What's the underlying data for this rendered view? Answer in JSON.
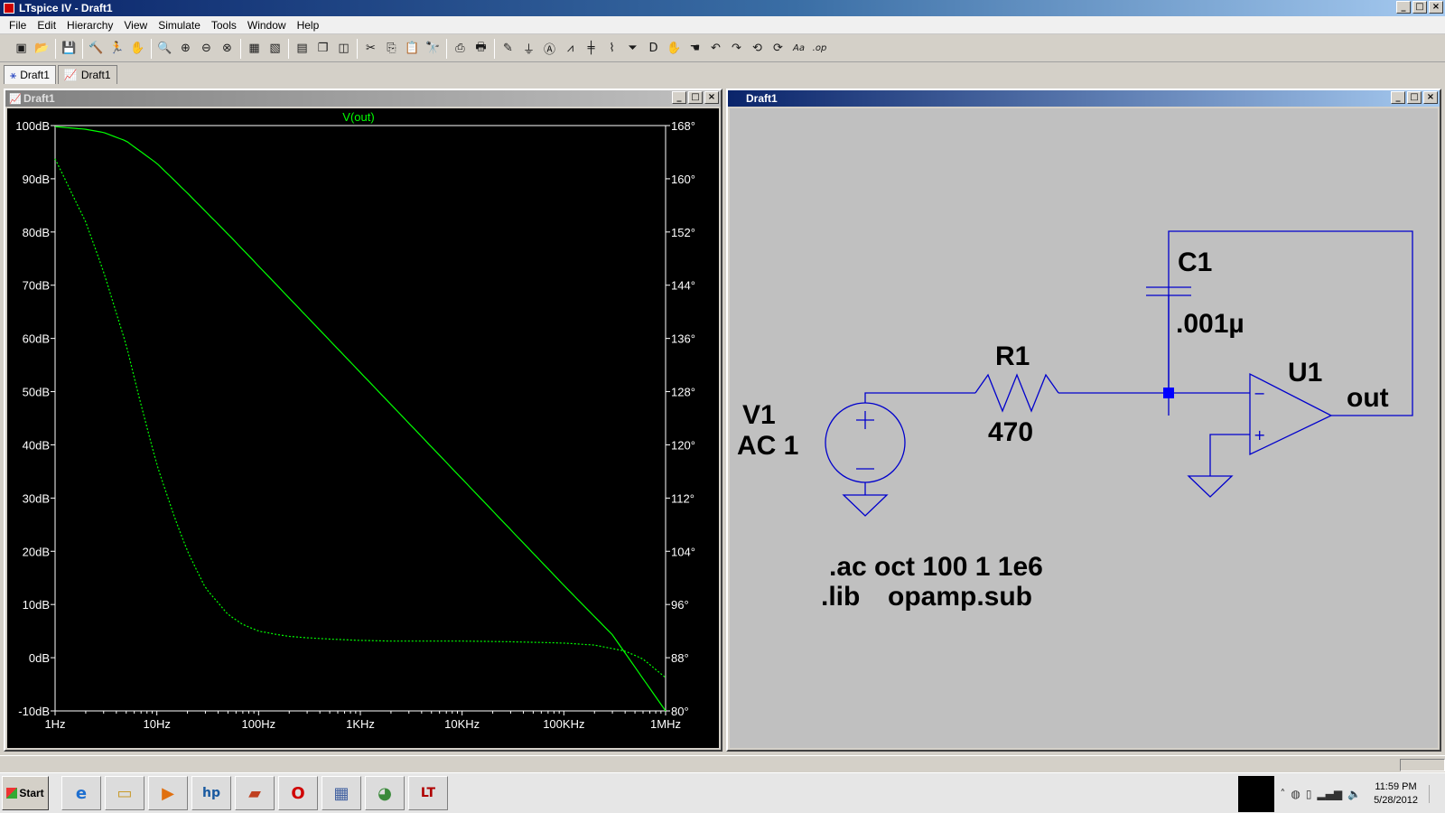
{
  "window": {
    "title": "LTspice IV - Draft1"
  },
  "window_controls": [
    "_",
    "□",
    "×"
  ],
  "menu": [
    "File",
    "Edit",
    "Hierarchy",
    "View",
    "Simulate",
    "Tools",
    "Window",
    "Help"
  ],
  "toolbar": {
    "groups": [
      [
        {
          "name": "new-schematic-icon",
          "glyph": "▣"
        },
        {
          "name": "open-icon",
          "glyph": "📂"
        }
      ],
      [
        {
          "name": "save-icon",
          "glyph": "💾"
        }
      ],
      [
        {
          "name": "control-panel-icon",
          "glyph": "🔨"
        },
        {
          "name": "run-icon",
          "glyph": "🏃"
        },
        {
          "name": "halt-icon",
          "glyph": "✋"
        }
      ],
      [
        {
          "name": "zoom-in-icon",
          "glyph": "🔍"
        },
        {
          "name": "zoom-pan-icon",
          "glyph": "⊕"
        },
        {
          "name": "zoom-out-icon",
          "glyph": "⊖"
        },
        {
          "name": "zoom-fit-icon",
          "glyph": "⊗"
        }
      ],
      [
        {
          "name": "autorange-icon",
          "glyph": "▦"
        },
        {
          "name": "delete-traces-icon",
          "glyph": "▧"
        }
      ],
      [
        {
          "name": "tile-horizontal-icon",
          "glyph": "▤"
        },
        {
          "name": "cascade-icon",
          "glyph": "❐"
        },
        {
          "name": "tile-vertical-icon",
          "glyph": "◫"
        }
      ],
      [
        {
          "name": "cut-icon",
          "glyph": "✂"
        },
        {
          "name": "copy-icon",
          "glyph": "⎘"
        },
        {
          "name": "paste-icon",
          "glyph": "📋"
        },
        {
          "name": "find-icon",
          "glyph": "🔭"
        }
      ],
      [
        {
          "name": "print-setup-icon",
          "glyph": "⎙"
        },
        {
          "name": "print-icon",
          "glyph": "🖶"
        }
      ],
      [
        {
          "name": "wire-icon",
          "glyph": "✎"
        },
        {
          "name": "ground-icon",
          "glyph": "⏚"
        },
        {
          "name": "label-net-icon",
          "glyph": "Ⓐ"
        },
        {
          "name": "resistor-icon",
          "glyph": "⩘"
        },
        {
          "name": "capacitor-icon",
          "glyph": "╪"
        },
        {
          "name": "inductor-icon",
          "glyph": "⌇"
        },
        {
          "name": "diode-icon",
          "glyph": "⏷"
        },
        {
          "name": "component-icon",
          "glyph": "D"
        },
        {
          "name": "move-icon",
          "glyph": "✋"
        },
        {
          "name": "drag-icon",
          "glyph": "☚"
        },
        {
          "name": "undo-icon",
          "glyph": "↶"
        },
        {
          "name": "redo-icon",
          "glyph": "↷"
        },
        {
          "name": "rotate-icon",
          "glyph": "⟲"
        },
        {
          "name": "mirror-icon",
          "glyph": "⟳"
        },
        {
          "name": "text-icon",
          "glyph": "Aa"
        },
        {
          "name": "spice-directive-icon",
          "glyph": ".op"
        }
      ]
    ]
  },
  "tabs": [
    {
      "label": "Draft1",
      "icon": "schematic-icon",
      "glyph": "⚹"
    },
    {
      "label": "Draft1",
      "icon": "waveform-icon",
      "glyph": "📈"
    }
  ],
  "waveform_window": {
    "title": "Draft1",
    "trace_label": "V(out)",
    "colors": {
      "background": "#000000",
      "trace": "#00ff00",
      "axis": "#ffffff",
      "label": "#00ff00"
    }
  },
  "chart_data": {
    "type": "line",
    "x_scale": "log",
    "xlim": [
      1,
      1000000
    ],
    "x_ticks": [
      {
        "v": 1,
        "label": "1Hz"
      },
      {
        "v": 10,
        "label": "10Hz"
      },
      {
        "v": 100,
        "label": "100Hz"
      },
      {
        "v": 1000,
        "label": "1KHz"
      },
      {
        "v": 10000,
        "label": "10KHz"
      },
      {
        "v": 100000,
        "label": "100KHz"
      },
      {
        "v": 1000000,
        "label": "1MHz"
      }
    ],
    "y_left": {
      "lim": [
        -10,
        100
      ],
      "ticks": [
        {
          "v": 100,
          "label": "100dB"
        },
        {
          "v": 90,
          "label": "90dB"
        },
        {
          "v": 80,
          "label": "80dB"
        },
        {
          "v": 70,
          "label": "70dB"
        },
        {
          "v": 60,
          "label": "60dB"
        },
        {
          "v": 50,
          "label": "50dB"
        },
        {
          "v": 40,
          "label": "40dB"
        },
        {
          "v": 30,
          "label": "30dB"
        },
        {
          "v": 20,
          "label": "20dB"
        },
        {
          "v": 10,
          "label": "10dB"
        },
        {
          "v": 0,
          "label": "0dB"
        },
        {
          "v": -10,
          "label": "-10dB"
        }
      ]
    },
    "y_right": {
      "lim": [
        80,
        168
      ],
      "ticks": [
        {
          "v": 168,
          "label": "168°"
        },
        {
          "v": 160,
          "label": "160°"
        },
        {
          "v": 152,
          "label": "152°"
        },
        {
          "v": 144,
          "label": "144°"
        },
        {
          "v": 136,
          "label": "136°"
        },
        {
          "v": 128,
          "label": "128°"
        },
        {
          "v": 120,
          "label": "120°"
        },
        {
          "v": 112,
          "label": "112°"
        },
        {
          "v": 104,
          "label": "104°"
        },
        {
          "v": 96,
          "label": "96°"
        },
        {
          "v": 88,
          "label": "88°"
        },
        {
          "v": 80,
          "label": "80°"
        }
      ]
    },
    "series": [
      {
        "name": "V(out)",
        "axis": "left",
        "style": "solid",
        "x": [
          1,
          2,
          3,
          5,
          10,
          20,
          50,
          100,
          1000,
          10000,
          100000,
          300000,
          1000000
        ],
        "y": [
          99.8,
          99.3,
          98.7,
          97.1,
          92.9,
          87.3,
          79.6,
          73.6,
          53.6,
          33.6,
          13.6,
          4.3,
          -10
        ]
      },
      {
        "name": "phase",
        "axis": "right",
        "style": "dotted",
        "x": [
          1,
          2,
          3,
          5,
          7,
          10,
          15,
          20,
          30,
          50,
          70,
          100,
          150,
          200,
          300,
          500,
          1000,
          2000,
          5000,
          10000,
          30000,
          100000,
          200000,
          400000,
          600000,
          1000000
        ],
        "y": [
          163.0,
          153.5,
          146.0,
          135.0,
          126.0,
          117.0,
          109.0,
          104.0,
          98.5,
          94.5,
          93.0,
          92.0,
          91.5,
          91.2,
          91.0,
          90.8,
          90.6,
          90.5,
          90.5,
          90.5,
          90.4,
          90.2,
          89.9,
          89.0,
          87.8,
          85.0
        ]
      }
    ]
  },
  "schematic_window": {
    "title": "Draft1",
    "colors": {
      "background": "#c0c0c0",
      "wire": "#0000cc",
      "junction": "#0000ff",
      "text": "#000000"
    },
    "labels": {
      "c1_name": "C1",
      "c1_value": ".001µ",
      "r1_name": "R1",
      "r1_value": "470",
      "u1_name": "U1",
      "out_label": "out",
      "v1_name": "V1",
      "v1_value": "AC 1",
      "directive_1": ".ac oct 100 1 1e6",
      "directive_2_a": ".lib",
      "directive_2_b": "opamp.sub",
      "minus_sign": "−",
      "plus_sign": "+"
    }
  },
  "taskbar": {
    "start_label": "Start",
    "apps": [
      {
        "name": "internet-explorer-icon",
        "glyph": "e",
        "color": "#1e6fd0"
      },
      {
        "name": "explorer-folder-icon",
        "glyph": "▭",
        "color": "#c89a2a"
      },
      {
        "name": "media-player-icon",
        "glyph": "▶",
        "color": "#e07010"
      },
      {
        "name": "hp-icon",
        "glyph": "hp",
        "color": "#1a5aa0"
      },
      {
        "name": "app-icon",
        "glyph": "▰",
        "color": "#c04020"
      },
      {
        "name": "opera-icon",
        "glyph": "O",
        "color": "#d00000"
      },
      {
        "name": "calculator-icon",
        "glyph": "▦",
        "color": "#4060a0"
      },
      {
        "name": "paint-icon",
        "glyph": "◕",
        "color": "#3a8a3a"
      },
      {
        "name": "ltspice-icon",
        "glyph": "LT",
        "color": "#b00000"
      }
    ],
    "tray": [
      {
        "name": "show-hidden-icon",
        "glyph": "˄"
      },
      {
        "name": "network-globe-icon",
        "glyph": "◍"
      },
      {
        "name": "device-icon",
        "glyph": "▯"
      },
      {
        "name": "signal-icon",
        "glyph": "▂▄▆"
      },
      {
        "name": "volume-icon",
        "glyph": "🔈"
      }
    ],
    "time": "11:59 PM",
    "date": "5/28/2012"
  }
}
